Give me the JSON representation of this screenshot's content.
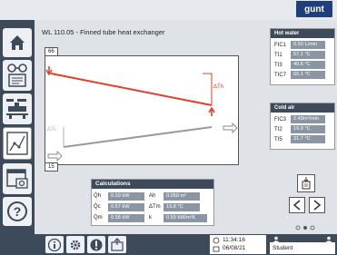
{
  "app": {
    "logo": "gunt",
    "title": "WL 110.05 - Finned tube heat exchanger"
  },
  "sidebar": {
    "items": [
      "home-icon",
      "glasses-document-icon",
      "apparatus-icon",
      "chart-icon",
      "camera-icon",
      "help-icon"
    ]
  },
  "plot": {
    "y_max_label": "66",
    "y_min_label": "15",
    "delta_th_label": "ΔTh",
    "delta_tc_label": "ΔTc",
    "hot_color": "#e53e2b",
    "cold_color": "#9a9a9a"
  },
  "hot_water": {
    "title": "Hot water",
    "rows": [
      {
        "label": "FIC1",
        "value": "0.50 L/min"
      },
      {
        "label": "TI1",
        "value": "57.1 °C"
      },
      {
        "label": "TI3",
        "value": "40.6 °C"
      },
      {
        "label": "TIC7",
        "value": "65.1 °C"
      }
    ]
  },
  "cold_air": {
    "title": "Cold air",
    "rows": [
      {
        "label": "FIC3",
        "value": "2.49m³/min"
      },
      {
        "label": "TI2",
        "value": "19.9 °C"
      },
      {
        "label": "TI5",
        "value": "31.7 °C"
      }
    ]
  },
  "calculations": {
    "title": "Calculations",
    "rows": [
      {
        "l1": "Q̇h",
        "v1": "0.59 kW",
        "l2": "Ah",
        "v2": "0.050 m²"
      },
      {
        "l1": "Q̇c",
        "v1": "0.57 kW",
        "l2": "ΔTm",
        "v2": "19.8 °C"
      },
      {
        "l1": "Q̇m",
        "v1": "0.58 kW",
        "l2": "k",
        "v2": "0.59 kW/m²K"
      }
    ]
  },
  "status": {
    "time": "11:34:16",
    "date": "06/08/21",
    "user": "Student"
  },
  "bottom": {
    "items": [
      "info-icon",
      "settings-icon",
      "warning-icon",
      "export-icon"
    ]
  }
}
